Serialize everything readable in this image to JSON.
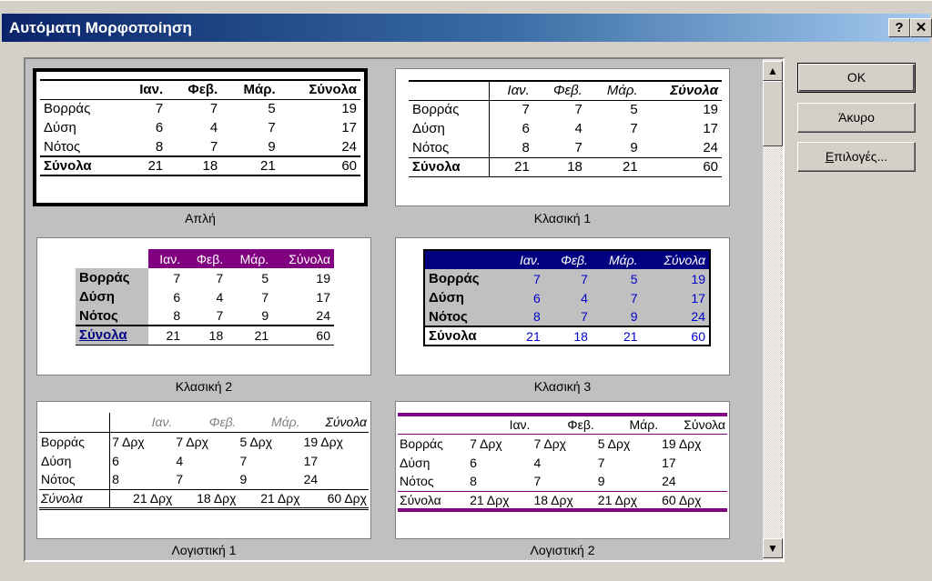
{
  "dialog": {
    "title": "Αυτόματη Μορφοποίηση",
    "help_button": "?",
    "close_button": "✕"
  },
  "buttons": {
    "ok": "OK",
    "cancel": "Άκυρο",
    "options_first": "Ε",
    "options_rest": "πιλογές..."
  },
  "scrollbar": {
    "up_icon": "▲",
    "down_icon": "▼"
  },
  "formats": [
    {
      "name": "Απλή",
      "header": [
        "",
        "Ιαν.",
        "Φεβ.",
        "Μάρ.",
        "Σύνολα"
      ],
      "rows": [
        [
          "Βορράς",
          "7",
          "7",
          "5",
          "19"
        ],
        [
          "Δύση",
          "6",
          "4",
          "7",
          "17"
        ],
        [
          "Νότος",
          "8",
          "7",
          "9",
          "24"
        ],
        [
          "Σύνολα",
          "21",
          "18",
          "21",
          "60"
        ]
      ]
    },
    {
      "name": "Κλασική 1",
      "header": [
        "",
        "Ιαν.",
        "Φεβ.",
        "Μάρ.",
        "Σύνολα"
      ],
      "rows": [
        [
          "Βορράς",
          "7",
          "7",
          "5",
          "19"
        ],
        [
          "Δύση",
          "6",
          "4",
          "7",
          "17"
        ],
        [
          "Νότος",
          "8",
          "7",
          "9",
          "24"
        ],
        [
          "Σύνολα",
          "21",
          "18",
          "21",
          "60"
        ]
      ]
    },
    {
      "name": "Κλασική 2",
      "header": [
        "",
        "Ιαν.",
        "Φεβ.",
        "Μάρ.",
        "Σύνολα"
      ],
      "rows": [
        [
          "Βορράς",
          "7",
          "7",
          "5",
          "19"
        ],
        [
          "Δύση",
          "6",
          "4",
          "7",
          "17"
        ],
        [
          "Νότος",
          "8",
          "7",
          "9",
          "24"
        ],
        [
          "Σύνολα",
          "21",
          "18",
          "21",
          "60"
        ]
      ]
    },
    {
      "name": "Κλασική 3",
      "header": [
        "",
        "Ιαν.",
        "Φεβ.",
        "Μάρ.",
        "Σύνολα"
      ],
      "rows": [
        [
          "Βορράς",
          "7",
          "7",
          "5",
          "19"
        ],
        [
          "Δύση",
          "6",
          "4",
          "7",
          "17"
        ],
        [
          "Νότος",
          "8",
          "7",
          "9",
          "24"
        ],
        [
          "Σύνολα",
          "21",
          "18",
          "21",
          "60"
        ]
      ]
    },
    {
      "name": "Λογιστική 1",
      "header": [
        "",
        "Ιαν.",
        "Φεβ.",
        "Μάρ.",
        "Σύνολα"
      ],
      "rows": [
        [
          "Βορράς",
          "7 Δρχ",
          "7 Δρχ",
          "5 Δρχ",
          "19 Δρχ"
        ],
        [
          "Δύση",
          "6",
          "4",
          "7",
          "17"
        ],
        [
          "Νότος",
          "8",
          "7",
          "9",
          "24"
        ],
        [
          "Σύνολα",
          "21 Δρχ",
          "18 Δρχ",
          "21 Δρχ",
          "60 Δρχ"
        ]
      ]
    },
    {
      "name": "Λογιστική 2",
      "header": [
        "",
        "Ιαν.",
        "Φεβ.",
        "Μάρ.",
        "Σύνολα"
      ],
      "rows": [
        [
          "Βορράς",
          "7 Δρχ",
          "7 Δρχ",
          "5 Δρχ",
          "19 Δρχ"
        ],
        [
          "Δύση",
          "6",
          "4",
          "7",
          "17"
        ],
        [
          "Νότος",
          "8",
          "7",
          "9",
          "24"
        ],
        [
          "Σύνολα",
          "21 Δρχ",
          "18 Δρχ",
          "21 Δρχ",
          "60 Δρχ"
        ]
      ]
    }
  ],
  "colors": {
    "titlebar_start": "#0a246a",
    "titlebar_end": "#a6caf0",
    "dialog_face": "#d4d0c8",
    "purple_accent": "#800080",
    "navy_accent": "#000080"
  }
}
